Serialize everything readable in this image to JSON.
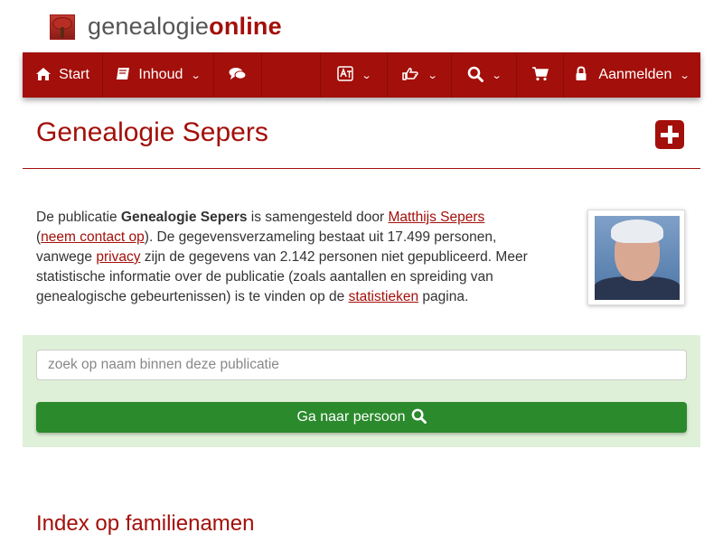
{
  "logo": {
    "prefix": "genealogie",
    "suffix": "online"
  },
  "nav": {
    "start_label": "Start",
    "inhoud_label": "Inhoud",
    "aanmelden_label": "Aanmelden",
    "icons": [
      "home-icon",
      "book-icon",
      "comments-icon",
      "translate-icon",
      "hand-pointer-icon",
      "search-icon",
      "cart-icon",
      "lock-icon"
    ]
  },
  "page": {
    "title": "Genealogie Sepers"
  },
  "intro": {
    "t1": "De publicatie ",
    "pub_name": "Genealogie Sepers",
    "t2": " is samengesteld door ",
    "author": "Matthijs Sepers",
    "t3": "(",
    "contact": "neem contact op",
    "t4": "). De gegevensverzameling bestaat uit 17.499 personen, vanwege ",
    "privacy": "privacy",
    "t5": " zijn de gegevens van 2.142 personen niet gepubliceerd. Meer statistische informatie over de publicatie (zoals aantallen en spreiding van genealogische gebeurtenissen) is te vinden op de ",
    "stats": "statistieken",
    "t6": " pagina."
  },
  "search": {
    "placeholder": "zoek op naam binnen deze publicatie",
    "button_label": "Ga naar persoon"
  },
  "index": {
    "title": "Index op familienamen"
  },
  "colors": {
    "brand": "#a30f0a",
    "panel": "#dff0d8",
    "button": "#2a8a2c"
  }
}
